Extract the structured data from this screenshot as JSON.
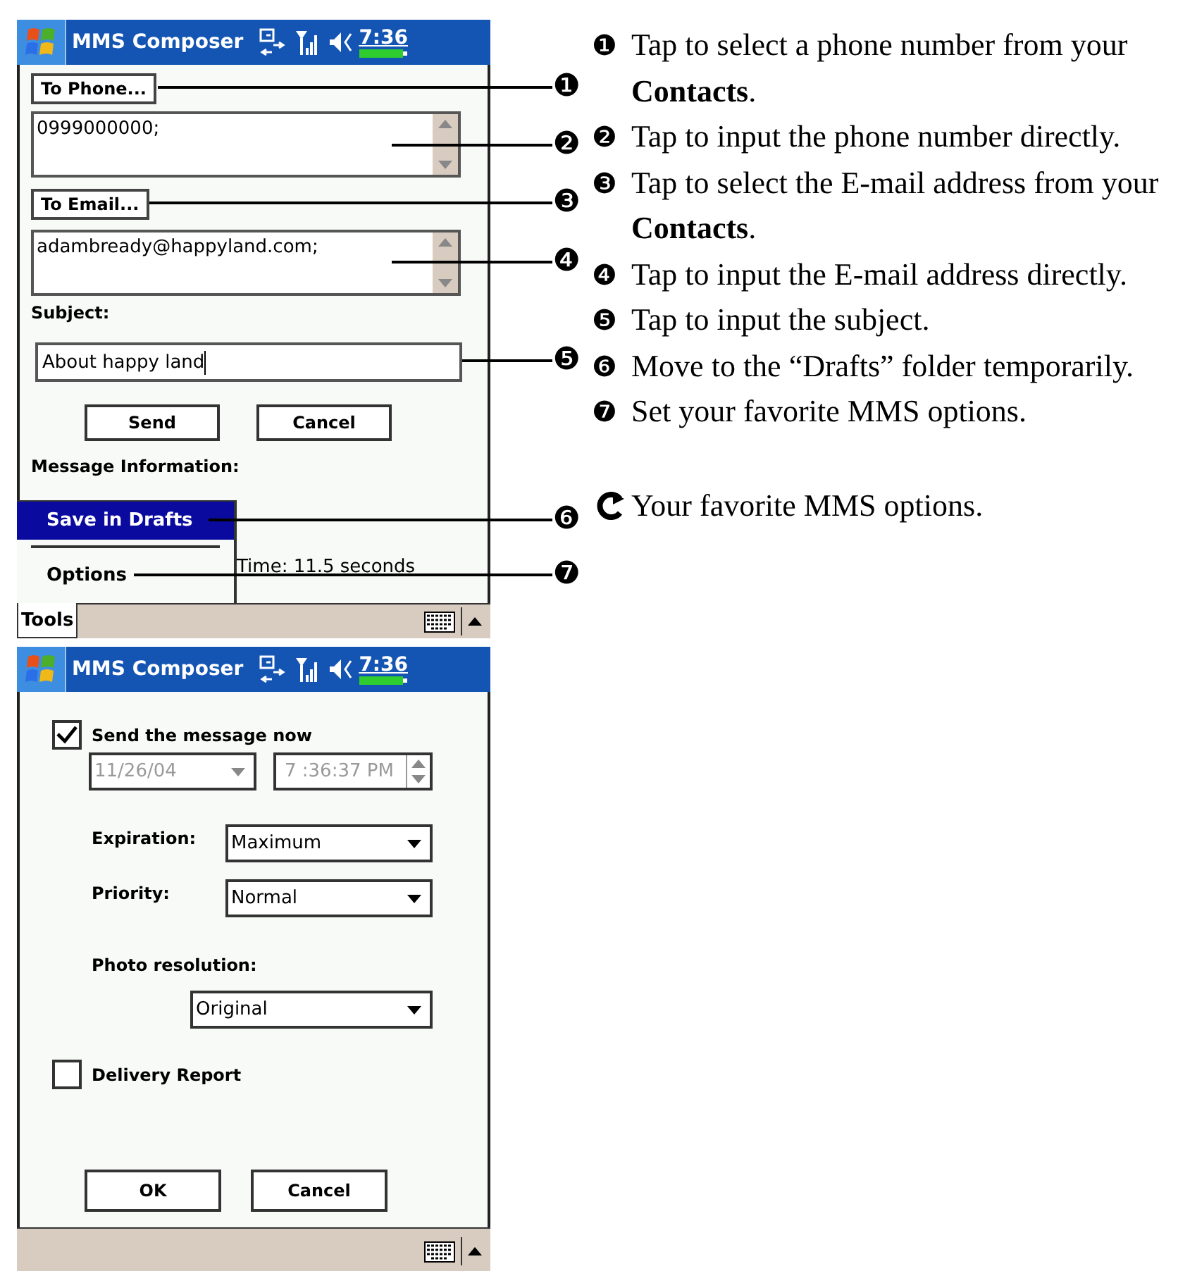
{
  "compose_screen": {
    "title": "MMS Composer",
    "time": "7:36",
    "to_phone_button": "To Phone...",
    "phone_field": {
      "value": "0999000000;"
    },
    "to_email_button": "To Email...",
    "email_field": {
      "value": "adambready@happyland.com;"
    },
    "subject_label": "Subject:",
    "subject_field": {
      "value": "About happy land"
    },
    "buttons": [
      "Send",
      "Cancel"
    ],
    "info_label": "Message Information:",
    "info_time": "Time: 11.5 seconds",
    "menu": {
      "items": [
        {
          "label": "Save in Drafts",
          "selected": true
        },
        {
          "label": "Options",
          "selected": false
        }
      ]
    },
    "menu_bar": {
      "label": "Tools"
    }
  },
  "options_screen": {
    "title": "MMS Composer",
    "time": "7:36",
    "send_now": {
      "label": "Send the message now",
      "checked": true
    },
    "date_field": {
      "value": "11/26/04",
      "disabled": true
    },
    "time_field": {
      "value": "7 :36:37 PM",
      "disabled": true
    },
    "expiration": {
      "label": "Expiration:",
      "value": "Maximum"
    },
    "priority": {
      "label": "Priority:",
      "value": "Normal"
    },
    "photo_resolution": {
      "label": "Photo resolution:",
      "value": "Original"
    },
    "delivery_report": {
      "label": "Delivery Report",
      "checked": false
    },
    "buttons": [
      "OK",
      "Cancel"
    ]
  },
  "callouts": [
    "❶",
    "❷",
    "❸",
    "❹",
    "❺",
    "❻",
    "❼"
  ],
  "notes": [
    {
      "number": "❶",
      "text": "Tap to select a phone number from your **Contacts**."
    },
    {
      "number": "❷",
      "text": "Tap to input the phone number directly."
    },
    {
      "number": "❸",
      "text": "Tap to select the E-mail address from your **Contacts**."
    },
    {
      "number": "❹",
      "text": "Tap to input the E-mail address directly."
    },
    {
      "number": "❺",
      "text": "Tap to input the subject."
    },
    {
      "number": "❻",
      "text": "Move to the “Drafts” folder temporarily."
    },
    {
      "number": "❼",
      "text": "Set your favorite MMS options."
    }
  ],
  "caption": "Your favorite MMS options."
}
